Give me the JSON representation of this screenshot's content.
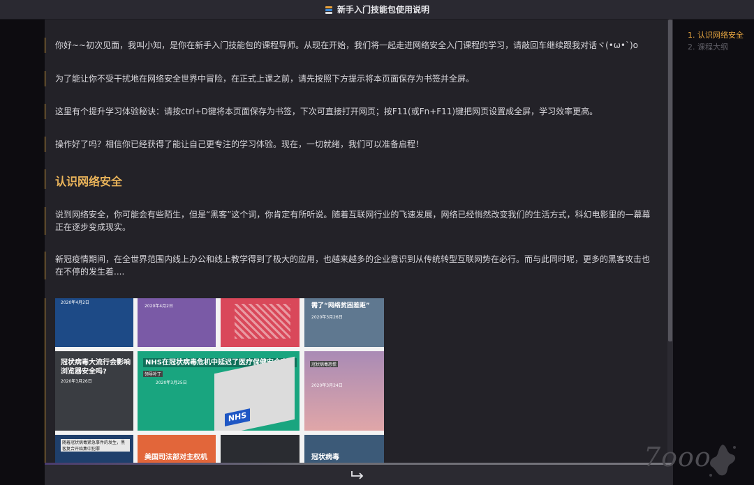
{
  "window": {
    "title": "新手入门技能包使用说明",
    "title_icon": "books-icon"
  },
  "messages": [
    {
      "text": "你好~~初次见面，我叫小知，是你在新手入门技能包的课程导师。从现在开始，我们将一起走进网络安全入门课程的学习，请敲回车继续跟我对话ヾ(•ω•`)o"
    },
    {
      "text": "为了能让你不受干扰地在网络安全世界中冒险，在正式上课之前，请先按照下方提示将本页面保存为书签并全屏。"
    },
    {
      "text": "这里有个提升学习体验秘诀：请按ctrl+D键将本页面保存为书签，下次可直接打开网页；按F11(或Fn+F11)键把网页设置成全屏，学习效率更高。"
    },
    {
      "text": "操作好了吗？相信你已经获得了能让自己更专注的学习体验。现在，一切就绪，我们可以准备启程！"
    },
    {
      "text": "说到网络安全，你可能会有些陌生，但是“黑客”这个词，你肯定有所听说。随着互联网行业的飞速发展，网络已经悄然改变我们的生活方式，科幻电影里的一幕幕正在逐步变成现实。"
    },
    {
      "text": "新冠疫情期间，在全世界范围内线上办公和线上教学得到了极大的应用，也越来越多的企业意识到从传统转型互联网势在必行。而与此同时呢，更多的黑客攻击也在不停的发生着...."
    }
  ],
  "section": {
    "quote_icon": "quote-icon",
    "title": "认识网络安全"
  },
  "news_tiles": [
    {
      "date": "2020年4月2日",
      "caption": "",
      "color": "#1d4a86"
    },
    {
      "date": "2020年4月2日",
      "caption": "",
      "color": "#7a5aa6"
    },
    {
      "date": "",
      "caption": "",
      "color": "#d9485a"
    },
    {
      "date": "2020年3月26日",
      "caption": "需了“网络贫困差距”",
      "color": "#5f7890"
    },
    {
      "date": "2020年3月26日",
      "caption": "冠状病毒大流行会影响浏览器安全吗?",
      "color": "#3a3d42"
    },
    {
      "date": "2020年3月25日",
      "caption": "NHS在冠状病毒危机中延迟了医疗保健安全审核",
      "color": "#19a57f",
      "tag": "领导补丁",
      "sign": "NHS"
    },
    {
      "date": "2020年3月24日",
      "caption": "冠状病毒恐慌",
      "color": "#a98bb5"
    },
    {
      "date": "",
      "caption": "随着冠状病毒紧急事件的发生，黑客复合开始集中犯罪",
      "color": "#1f3f6b"
    },
    {
      "date": "",
      "caption": "美国司法部对主权机",
      "color": "#e2663a"
    },
    {
      "date": "",
      "caption": "",
      "color": "#2a2c31"
    },
    {
      "date": "",
      "caption": "冠状病毒",
      "color": "#3c5a78"
    }
  ],
  "toc": [
    {
      "label": "1. 认识网络安全",
      "active": true
    },
    {
      "label": "2. 课程大纲",
      "active": false
    }
  ],
  "input": {
    "enter_icon": "enter-arrow-icon"
  },
  "watermark": "7ooo"
}
